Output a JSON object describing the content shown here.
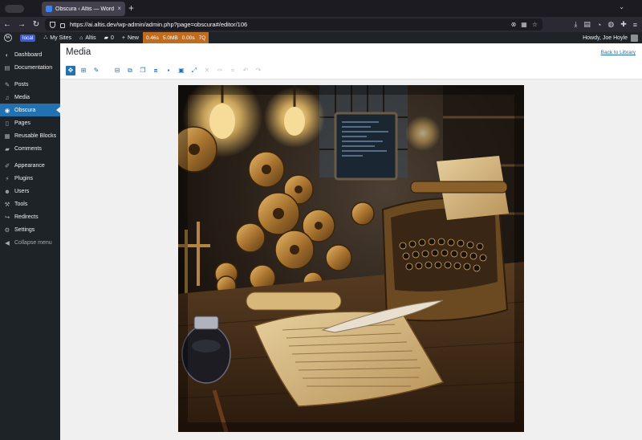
{
  "browser": {
    "tab_title": "Obscura ‹ Altis — WordPress",
    "tab_close": "×",
    "new_tab": "+",
    "url": "https://ai.altis.dev/wp-admin/admin.php?page=obscura#/editor/106",
    "nav_back": "←",
    "nav_forward": "→",
    "nav_reload": "↻"
  },
  "adminbar": {
    "env": "local",
    "my_sites": "My Sites",
    "site_name": "Altis",
    "comments_count": "0",
    "new_label": "New",
    "perf": [
      "0.46s",
      "5.0MB",
      "0.00s",
      "7Q"
    ],
    "greeting": "Howdy, Joe Hoyle"
  },
  "sidebar": {
    "items": [
      {
        "label": "Dashboard",
        "icon": "dashboard-icon"
      },
      {
        "label": "Documentation",
        "icon": "book-icon"
      },
      {
        "label": "Posts",
        "icon": "pin-icon"
      },
      {
        "label": "Media",
        "icon": "media-icon"
      },
      {
        "label": "Obscura",
        "icon": "camera-icon",
        "current": true
      },
      {
        "label": "Pages",
        "icon": "page-icon"
      },
      {
        "label": "Reusable Blocks",
        "icon": "blocks-icon"
      },
      {
        "label": "Comments",
        "icon": "comment-icon"
      },
      {
        "label": "Appearance",
        "icon": "brush-icon"
      },
      {
        "label": "Plugins",
        "icon": "plug-icon"
      },
      {
        "label": "Users",
        "icon": "user-icon"
      },
      {
        "label": "Tools",
        "icon": "wrench-icon"
      },
      {
        "label": "Redirects",
        "icon": "redirect-icon"
      },
      {
        "label": "Settings",
        "icon": "settings-icon"
      }
    ],
    "collapse_label": "Collapse menu"
  },
  "main": {
    "title": "Media",
    "back_link": "Back to Library"
  },
  "colors": {
    "wp_blue": "#2271b1",
    "admin_dark": "#1d2327",
    "perf_orange": "#c06c1e"
  }
}
